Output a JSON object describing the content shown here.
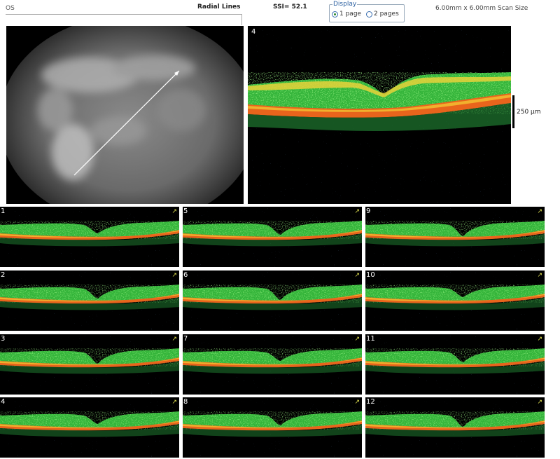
{
  "header": {
    "eye": "OS",
    "scan_type": "Radial Lines",
    "ssi": "SSI= 52.1",
    "display_legend": "Display",
    "display_options": [
      "1 page",
      "2 pages"
    ],
    "display_selected": "1 page",
    "scan_size": "6.00mm x 6.00mm Scan Size"
  },
  "main_scan": {
    "number": "4",
    "scale_label": "250 µm"
  },
  "thumbnails": [
    "1",
    "2",
    "3",
    "4",
    "5",
    "6",
    "7",
    "8",
    "9",
    "10",
    "11",
    "12"
  ],
  "colors": {
    "retina_green": "#3ec23a",
    "rpe_orange": "#e8641c",
    "background": "#000000"
  }
}
